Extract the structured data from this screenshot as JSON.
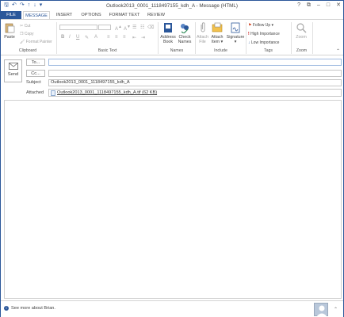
{
  "title_bar": {
    "title": "Outlook2013_0001_1118497155_kdh_A - Message (HTML)",
    "controls": [
      "?",
      "⧉",
      "–",
      "□",
      "✕"
    ]
  },
  "tabs": [
    {
      "label": "FILE"
    },
    {
      "label": "MESSAGE"
    },
    {
      "label": "INSERT"
    },
    {
      "label": "OPTIONS"
    },
    {
      "label": "FORMAT TEXT"
    },
    {
      "label": "REVIEW"
    }
  ],
  "ribbon": {
    "clipboard": {
      "paste": "Paste",
      "cut": "Cut",
      "copy": "Copy",
      "format_painter": "Format Painter",
      "label": "Clipboard"
    },
    "basic_text": {
      "label": "Basic Text"
    },
    "names": {
      "address_book_1": "Address",
      "address_book_2": "Book",
      "check_names_1": "Check",
      "check_names_2": "Names",
      "label": "Names"
    },
    "include": {
      "attach_file_1": "Attach",
      "attach_file_2": "File",
      "attach_item_1": "Attach",
      "attach_item_2": "Item ▾",
      "signature_1": "Signature",
      "signature_2": "▾",
      "label": "Include"
    },
    "tags": {
      "follow_up": "Follow Up ▾",
      "high_importance": "High Importance",
      "low_importance": "Low Importance",
      "label": "Tags"
    },
    "zoom": {
      "zoom": "Zoom",
      "label": "Zoom"
    }
  },
  "compose": {
    "send": "Send",
    "to": "To...",
    "cc": "Cc...",
    "subject_label": "Subject",
    "subject_value": "Outlook2013_0001_1118497155_kdh_A",
    "attached_label": "Attached",
    "attachment": "Outlook2013_0001_1118497155_kdh_A.tif (62 KB)"
  },
  "status_bar": {
    "text": "See more about Brian."
  },
  "colors": {
    "accent": "#2b579a",
    "flag": "#d24726",
    "importance_high": "#c00000",
    "importance_low": "#2b579a"
  }
}
